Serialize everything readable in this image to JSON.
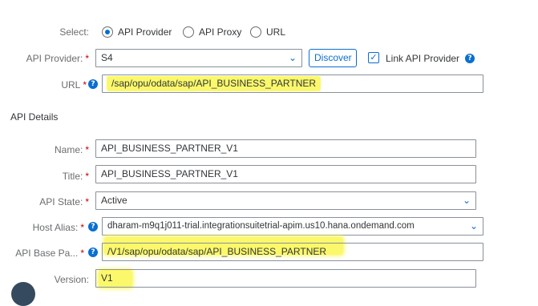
{
  "select": {
    "label": "Select:",
    "options": [
      "API Provider",
      "API Proxy",
      "URL"
    ],
    "selected": "API Provider"
  },
  "provider": {
    "label": "API Provider:",
    "value": "S4",
    "discover_label": "Discover",
    "link_label": "Link API Provider",
    "link_checked": true
  },
  "url": {
    "label": "URL",
    "value": "/sap/opu/odata/sap/API_BUSINESS_PARTNER"
  },
  "details": {
    "heading": "API Details",
    "name": {
      "label": "Name:",
      "value": "API_BUSINESS_PARTNER_V1"
    },
    "title": {
      "label": "Title:",
      "value": "API_BUSINESS_PARTNER_V1"
    },
    "state": {
      "label": "API State:",
      "value": "Active"
    },
    "host_alias": {
      "label": "Host Alias:",
      "value": "dharam-m9q1j011-trial.integrationsuitetrial-apim.us10.hana.ondemand.com"
    },
    "base_path": {
      "label": "API Base Pa...",
      "value": "/V1/sap/opu/odata/sap/API_BUSINESS_PARTNER"
    },
    "version": {
      "label": "Version:",
      "value": "V1"
    }
  },
  "required_marker": "*",
  "colors": {
    "accent": "#0a6ed1",
    "required": "#bb0000",
    "highlight": "#fbf86b"
  }
}
